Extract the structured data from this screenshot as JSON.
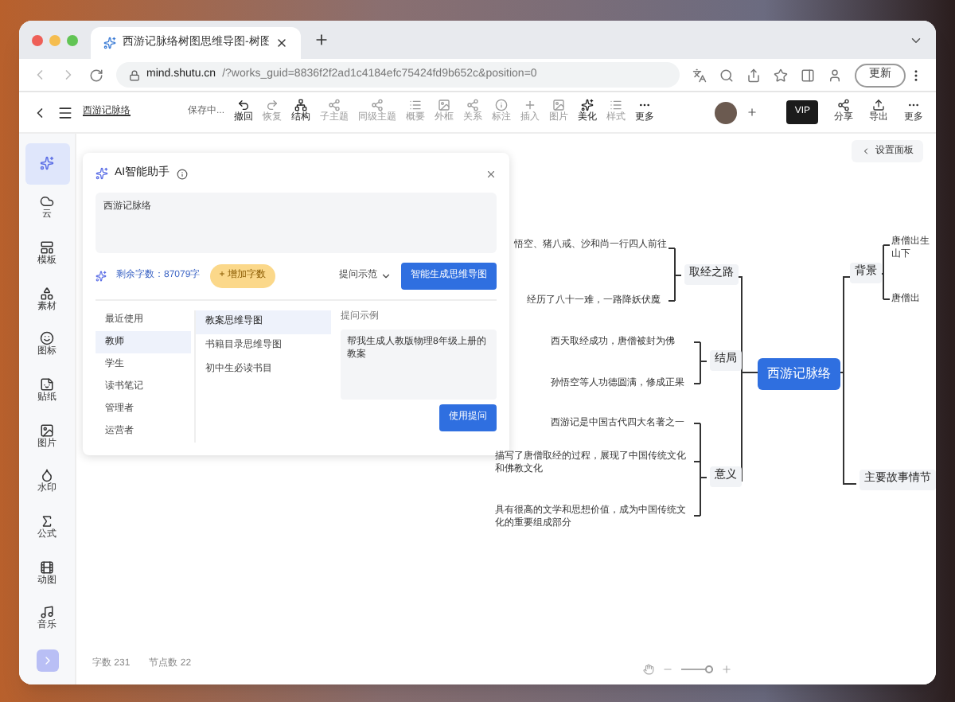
{
  "browser": {
    "tab_title": "西游记脉络树图思维导图-树图",
    "url_host": "mind.shutu.cn",
    "url_path": "/?works_guid=8836f2f2ad1c4184efc75424fd9b652c&position=0",
    "update_button": "更新"
  },
  "toolbar": {
    "doc_title": "西游记脉络",
    "status": "保存中...",
    "items": [
      {
        "label": "撤回",
        "disabled": false
      },
      {
        "label": "恢复",
        "disabled": true
      },
      {
        "label": "结构",
        "disabled": false
      },
      {
        "label": "子主题",
        "disabled": true
      },
      {
        "label": "同级主题",
        "disabled": true
      },
      {
        "label": "概要",
        "disabled": true
      },
      {
        "label": "外框",
        "disabled": true
      },
      {
        "label": "关系",
        "disabled": true
      },
      {
        "label": "标注",
        "disabled": true
      },
      {
        "label": "插入",
        "disabled": true
      },
      {
        "label": "图片",
        "disabled": true
      },
      {
        "label": "美化",
        "disabled": false
      },
      {
        "label": "样式",
        "disabled": true
      },
      {
        "label": "更多",
        "disabled": false
      }
    ],
    "vip": "VIP",
    "right_items": [
      "分享",
      "导出",
      "更多"
    ]
  },
  "sidebar": [
    {
      "selected": true
    },
    {
      "label": "云",
      "selected": false
    },
    {
      "label": "模板",
      "selected": false
    },
    {
      "label": "素材",
      "selected": false
    },
    {
      "label": "图标",
      "selected": false
    },
    {
      "label": "贴纸",
      "selected": false
    },
    {
      "label": "图片",
      "selected": false
    },
    {
      "label": "水印",
      "selected": false
    },
    {
      "label": "公式",
      "selected": false
    },
    {
      "label": "动图",
      "selected": false
    },
    {
      "label": "音乐",
      "selected": false
    }
  ],
  "ai_panel": {
    "title": "AI智能助手",
    "input": "西游记脉络",
    "remaining": "剩余字数：87079字",
    "add_words": "+ 增加字数",
    "examples_dropdown": "提问示范",
    "generate_button": "智能生成思维导图",
    "categories": [
      {
        "label": "最近使用",
        "selected": false
      },
      {
        "label": "教师",
        "selected": true
      },
      {
        "label": "学生",
        "selected": false
      },
      {
        "label": "读书笔记",
        "selected": false
      },
      {
        "label": "管理者",
        "selected": false
      },
      {
        "label": "运营者",
        "selected": false
      }
    ],
    "templates": [
      {
        "label": "教案思维导图",
        "selected": true
      },
      {
        "label": "书籍目录思维导图",
        "selected": false
      },
      {
        "label": "初中生必读书目",
        "selected": false
      }
    ],
    "example_label": "提问示例",
    "example_text": "帮我生成人教版物理8年级上册的教案",
    "use_button": "使用提问"
  },
  "settings_button": "设置面板",
  "mindmap": {
    "root": "西游记脉络",
    "left": [
      {
        "label": "取经之路",
        "children": [
          "悟空、猪八戒、沙和尚一行四人前往",
          "经历了八十一难，一路降妖伏魔"
        ]
      },
      {
        "label": "结局",
        "children": [
          "西天取经成功，唐僧被封为佛",
          "孙悟空等人功德圆满，修成正果"
        ]
      },
      {
        "label": "意义",
        "children": [
          "西游记是中国古代四大名著之一",
          "描写了唐僧取经的过程，展现了中国传统文化和佛教文化",
          "具有很高的文学和思想价值，成为中国传统文化的重要组成部分"
        ]
      }
    ],
    "right": [
      {
        "label": "背景",
        "children": [
          "唐僧出生山下",
          "唐僧出"
        ]
      },
      {
        "label": "主要故事情节"
      }
    ]
  },
  "zoom": {
    "level": 0.85
  },
  "status_bar": {
    "word_count": "字数 231",
    "node_count": "节点数 22"
  }
}
